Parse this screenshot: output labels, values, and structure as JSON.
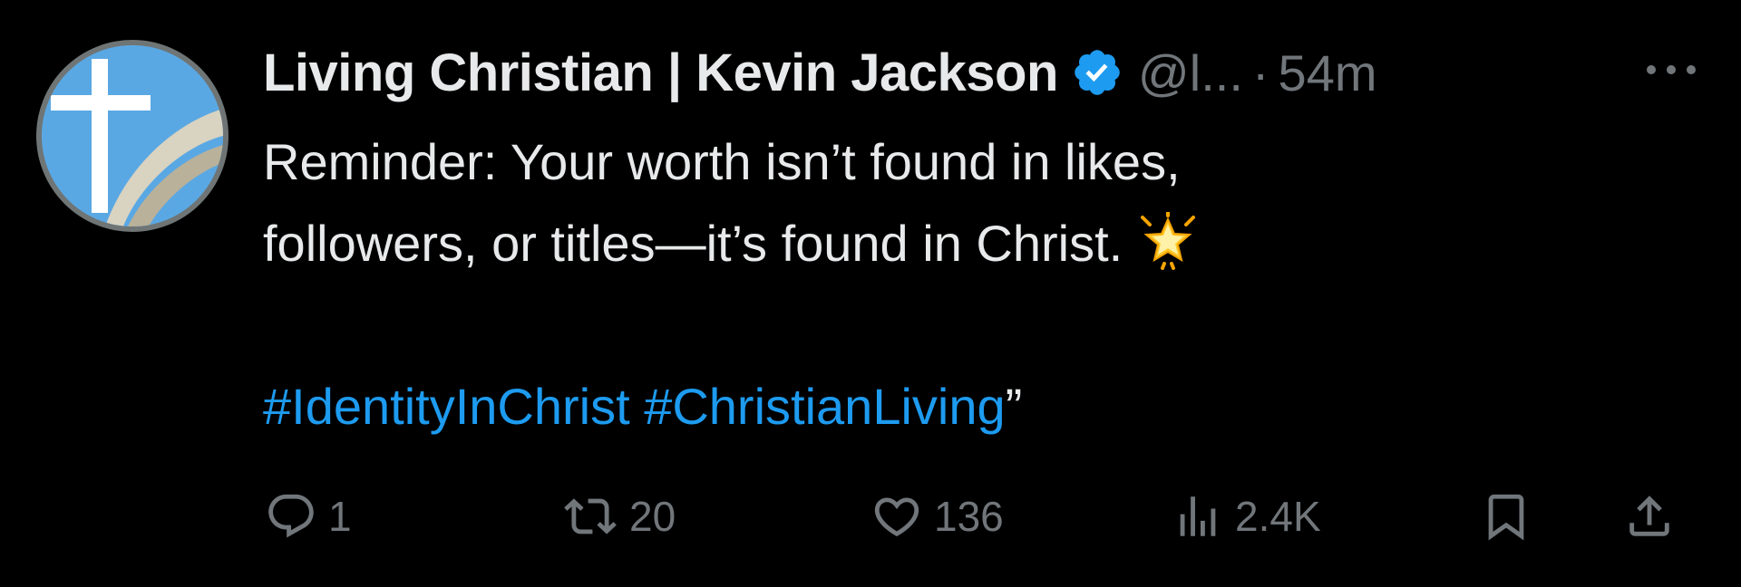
{
  "author": {
    "display_name": "Living Christian | Kevin Jackson",
    "handle": "@l...",
    "separator": "·",
    "timestamp": "54m",
    "verified": true,
    "verified_color": "#1d9bf0"
  },
  "avatar": {
    "icon": "cross-logo-icon",
    "background_color": "#5aa8e3"
  },
  "body": {
    "line1": "Reminder: Your worth isn’t found in likes,",
    "line2": "followers, or titles—it’s found in Christ.",
    "emoji": "glowing-star-icon",
    "hashtags": [
      {
        "text": "#IdentityInChrist"
      },
      {
        "text": "#ChristianLiving"
      }
    ],
    "hashtag_separator": " ",
    "trailing": "”",
    "hashtag_color": "#1d9bf0"
  },
  "actions": {
    "reply": {
      "icon": "reply-icon",
      "count": "1"
    },
    "retweet": {
      "icon": "retweet-icon",
      "count": "20"
    },
    "like": {
      "icon": "heart-icon",
      "count": "136"
    },
    "views": {
      "icon": "views-icon",
      "count": "2.4K"
    },
    "bookmark": {
      "icon": "bookmark-icon"
    },
    "share": {
      "icon": "share-icon"
    },
    "muted_color": "#71767b"
  },
  "colors": {
    "background": "#000000",
    "text": "#e7e9ea",
    "muted": "#71767b",
    "accent": "#1d9bf0"
  }
}
